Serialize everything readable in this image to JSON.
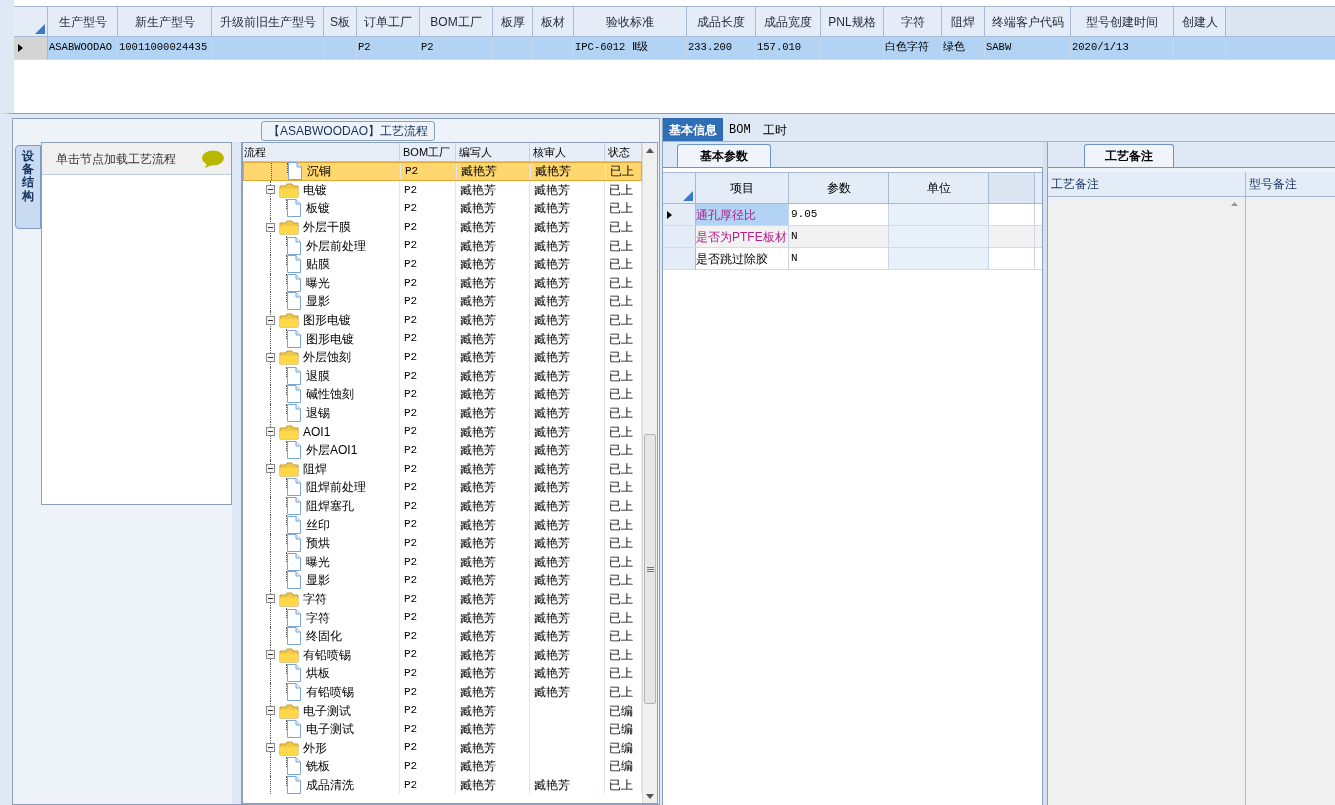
{
  "model_table": {
    "columns": [
      "生产型号",
      "新生产型号",
      "升级前旧生产型号",
      "S板",
      "订单工厂",
      "BOM工厂",
      "板厚",
      "板材",
      "验收标准",
      "成品长度",
      "成品宽度",
      "PNL规格",
      "字符",
      "阻焊",
      "终端客户代码",
      "型号创建时间",
      "创建人"
    ],
    "rows": [
      {
        "selected": true,
        "cells": [
          "ASABWOODAO",
          "10011000024435",
          "",
          "",
          "P2",
          "P2",
          "",
          "",
          "IPC-6012 Ⅱ级",
          "233.200",
          "157.010",
          "",
          "白色字符",
          "绿色",
          "SABW",
          "2020/1/13",
          ""
        ]
      }
    ]
  },
  "side_tab": {
    "label": "设备结构"
  },
  "side_list": {
    "items": [
      {
        "label": "单击节点加载工艺流程"
      }
    ]
  },
  "process_group": {
    "title": "【ASABWOODAO】工艺流程"
  },
  "process_tree": {
    "columns": [
      "流程",
      "BOM工厂",
      "编写人",
      "核审人",
      "状态"
    ],
    "rows": [
      {
        "children": [
          {
            "label": "沉铜",
            "bom": "P2",
            "writer": "臧艳芳",
            "reviewer": "臧艳芳",
            "status": "已上",
            "selected": true
          }
        ]
      },
      {
        "label": "电镀",
        "bom": "P2",
        "writer": "臧艳芳",
        "reviewer": "臧艳芳",
        "status": "已上",
        "selected": false,
        "children": [
          {
            "label": "板镀",
            "bom": "P2",
            "writer": "臧艳芳",
            "reviewer": "臧艳芳",
            "status": "已上",
            "selected": false
          }
        ]
      },
      {
        "label": "外层干膜",
        "bom": "P2",
        "writer": "臧艳芳",
        "reviewer": "臧艳芳",
        "status": "已上",
        "selected": false,
        "children": [
          {
            "label": "外层前处理",
            "bom": "P2",
            "writer": "臧艳芳",
            "reviewer": "臧艳芳",
            "status": "已上",
            "selected": false
          },
          {
            "label": "贴膜",
            "bom": "P2",
            "writer": "臧艳芳",
            "reviewer": "臧艳芳",
            "status": "已上",
            "selected": false
          },
          {
            "label": "曝光",
            "bom": "P2",
            "writer": "臧艳芳",
            "reviewer": "臧艳芳",
            "status": "已上",
            "selected": false
          },
          {
            "label": "显影",
            "bom": "P2",
            "writer": "臧艳芳",
            "reviewer": "臧艳芳",
            "status": "已上",
            "selected": false
          }
        ]
      },
      {
        "label": "图形电镀",
        "bom": "P2",
        "writer": "臧艳芳",
        "reviewer": "臧艳芳",
        "status": "已上",
        "selected": false,
        "children": [
          {
            "label": "图形电镀",
            "bom": "P2",
            "writer": "臧艳芳",
            "reviewer": "臧艳芳",
            "status": "已上",
            "selected": false
          }
        ]
      },
      {
        "label": "外层蚀刻",
        "bom": "P2",
        "writer": "臧艳芳",
        "reviewer": "臧艳芳",
        "status": "已上",
        "selected": false,
        "children": [
          {
            "label": "退膜",
            "bom": "P2",
            "writer": "臧艳芳",
            "reviewer": "臧艳芳",
            "status": "已上",
            "selected": false
          },
          {
            "label": "碱性蚀刻",
            "bom": "P2",
            "writer": "臧艳芳",
            "reviewer": "臧艳芳",
            "status": "已上",
            "selected": false
          },
          {
            "label": "退锡",
            "bom": "P2",
            "writer": "臧艳芳",
            "reviewer": "臧艳芳",
            "status": "已上",
            "selected": false
          }
        ]
      },
      {
        "label": "AOI1",
        "bom": "P2",
        "writer": "臧艳芳",
        "reviewer": "臧艳芳",
        "status": "已上",
        "selected": false,
        "children": [
          {
            "label": "外层AOI1",
            "bom": "P2",
            "writer": "臧艳芳",
            "reviewer": "臧艳芳",
            "status": "已上",
            "selected": false
          }
        ]
      },
      {
        "label": "阻焊",
        "bom": "P2",
        "writer": "臧艳芳",
        "reviewer": "臧艳芳",
        "status": "已上",
        "selected": false,
        "children": [
          {
            "label": "阻焊前处理",
            "bom": "P2",
            "writer": "臧艳芳",
            "reviewer": "臧艳芳",
            "status": "已上",
            "selected": false
          },
          {
            "label": "阻焊塞孔",
            "bom": "P2",
            "writer": "臧艳芳",
            "reviewer": "臧艳芳",
            "status": "已上",
            "selected": false
          },
          {
            "label": "丝印",
            "bom": "P2",
            "writer": "臧艳芳",
            "reviewer": "臧艳芳",
            "status": "已上",
            "selected": false
          },
          {
            "label": "预烘",
            "bom": "P2",
            "writer": "臧艳芳",
            "reviewer": "臧艳芳",
            "status": "已上",
            "selected": false
          },
          {
            "label": "曝光",
            "bom": "P2",
            "writer": "臧艳芳",
            "reviewer": "臧艳芳",
            "status": "已上",
            "selected": false
          },
          {
            "label": "显影",
            "bom": "P2",
            "writer": "臧艳芳",
            "reviewer": "臧艳芳",
            "status": "已上",
            "selected": false
          }
        ]
      },
      {
        "label": "字符",
        "bom": "P2",
        "writer": "臧艳芳",
        "reviewer": "臧艳芳",
        "status": "已上",
        "selected": false,
        "children": [
          {
            "label": "字符",
            "bom": "P2",
            "writer": "臧艳芳",
            "reviewer": "臧艳芳",
            "status": "已上",
            "selected": false
          },
          {
            "label": "终固化",
            "bom": "P2",
            "writer": "臧艳芳",
            "reviewer": "臧艳芳",
            "status": "已上",
            "selected": false
          }
        ]
      },
      {
        "label": "有铅喷锡",
        "bom": "P2",
        "writer": "臧艳芳",
        "reviewer": "臧艳芳",
        "status": "已上",
        "selected": false,
        "children": [
          {
            "label": "烘板",
            "bom": "P2",
            "writer": "臧艳芳",
            "reviewer": "臧艳芳",
            "status": "已上",
            "selected": false
          },
          {
            "label": "有铅喷锡",
            "bom": "P2",
            "writer": "臧艳芳",
            "reviewer": "臧艳芳",
            "status": "已上",
            "selected": false
          }
        ]
      },
      {
        "label": "电子测试",
        "bom": "P2",
        "writer": "臧艳芳",
        "status": "已编",
        "selected": false,
        "children": [
          {
            "label": "电子测试",
            "bom": "P2",
            "writer": "臧艳芳",
            "status": "已编",
            "selected": false
          }
        ]
      },
      {
        "label": "外形",
        "bom": "P2",
        "writer": "臧艳芳",
        "status": "已编",
        "selected": false,
        "children": [
          {
            "label": "铣板",
            "bom": "P2",
            "writer": "臧艳芳",
            "status": "已编",
            "selected": false
          },
          {
            "label": "成品清洗",
            "bom": "P2",
            "writer": "臧艳芳",
            "reviewer": "臧艳芳",
            "status": "已上",
            "selected": false
          }
        ]
      }
    ]
  },
  "info_tabs": [
    {
      "label": "基本信息",
      "selected": true
    },
    {
      "label": "BOM",
      "selected": false
    },
    {
      "label": "工时",
      "selected": false
    }
  ],
  "params_tab": {
    "label": "基本参数"
  },
  "params_table": {
    "columns": [
      "项目",
      "参数",
      "单位"
    ],
    "rows": [
      {
        "selected": true,
        "highlighted": true,
        "item": "通孔厚径比",
        "value": "9.05"
      },
      {
        "selected": false,
        "highlighted": true,
        "item": "是否为PTFE板材",
        "value": "N"
      },
      {
        "selected": false,
        "highlighted": false,
        "item": "是否跳过除胶",
        "value": "N"
      }
    ]
  },
  "notes_tab": {
    "label": "工艺备注"
  },
  "notes_table": {
    "columns": [
      "工艺备注",
      "型号备注"
    ]
  }
}
